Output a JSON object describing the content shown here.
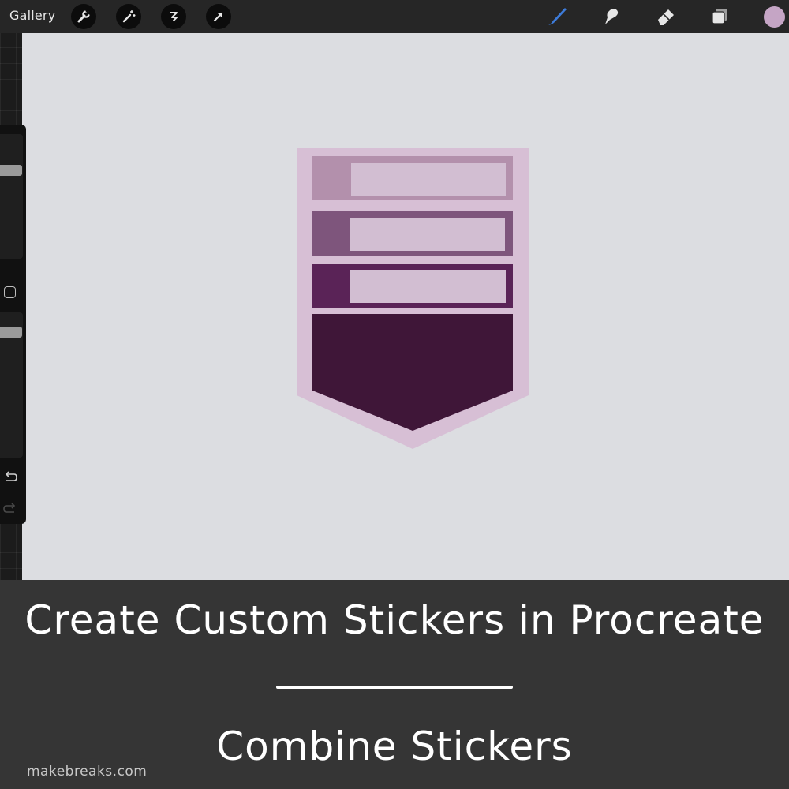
{
  "toolbar": {
    "gallery_label": "Gallery",
    "left_tools": [
      "wrench-icon",
      "magic-wand-icon",
      "selection-icon",
      "transform-arrow-icon"
    ],
    "right_tools": [
      "brush-icon",
      "smudge-icon",
      "eraser-icon",
      "layers-icon"
    ],
    "current_color": "#c5a5c5",
    "active_tool_color": "#3d7bd9"
  },
  "sidebar": {
    "controls": [
      "brush-size-slider",
      "modify-button",
      "opacity-slider",
      "undo-icon",
      "redo-icon"
    ]
  },
  "artwork": {
    "shape": "shield sticker with three banners",
    "colors": {
      "outer_border": "#d7bfd5",
      "label_box": "#d2bed2",
      "band_1": "#b390ac",
      "band_2": "#7e557c",
      "band_3": "#5a2357",
      "bottom_shield": "#3f1638",
      "canvas_background": "#dcdde1"
    }
  },
  "banner": {
    "headline": "Create Custom Stickers in Procreate",
    "subheadline": "Combine Stickers",
    "credit": "makebreaks.com"
  }
}
